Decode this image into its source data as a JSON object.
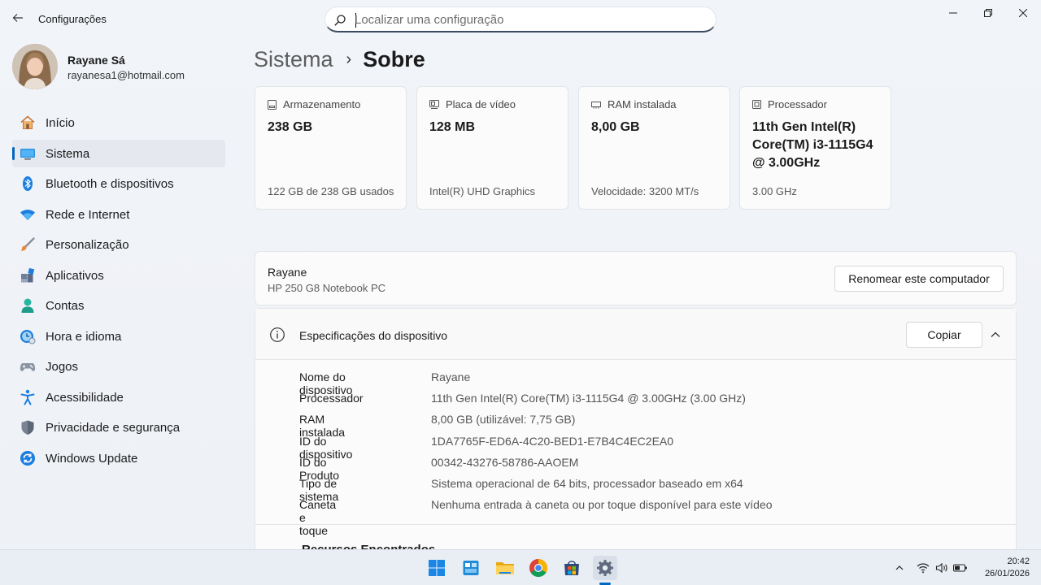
{
  "window": {
    "title": "Configurações",
    "back_icon": "back-arrow-icon",
    "controls": [
      "minimize-icon",
      "maximize-icon",
      "close-icon"
    ]
  },
  "search": {
    "placeholder": "Localizar uma configuração",
    "value": ""
  },
  "profile": {
    "name": "Rayane Sá",
    "email": "rayanesa1@hotmail.com"
  },
  "sidebar": {
    "items": [
      {
        "label": "Início",
        "icon": "home-icon",
        "active": false
      },
      {
        "label": "Sistema",
        "icon": "monitor-icon",
        "active": true
      },
      {
        "label": "Bluetooth e dispositivos",
        "icon": "bluetooth-icon",
        "active": false
      },
      {
        "label": "Rede e Internet",
        "icon": "wifi-icon",
        "active": false
      },
      {
        "label": "Personalização",
        "icon": "brush-icon",
        "active": false
      },
      {
        "label": "Aplicativos",
        "icon": "apps-icon",
        "active": false
      },
      {
        "label": "Contas",
        "icon": "person-icon",
        "active": false
      },
      {
        "label": "Hora e idioma",
        "icon": "clock-globe-icon",
        "active": false
      },
      {
        "label": "Jogos",
        "icon": "gamepad-icon",
        "active": false
      },
      {
        "label": "Acessibilidade",
        "icon": "accessibility-icon",
        "active": false
      },
      {
        "label": "Privacidade e segurança",
        "icon": "shield-icon",
        "active": false
      },
      {
        "label": "Windows Update",
        "icon": "update-icon",
        "active": false
      }
    ]
  },
  "breadcrumb": {
    "parent": "Sistema",
    "separator": "›",
    "current": "Sobre"
  },
  "cards": [
    {
      "title": "Armazenamento",
      "value": "238 GB",
      "sub": "122 GB de 238 GB usados",
      "icon": "storage-icon"
    },
    {
      "title": "Placa de vídeo",
      "value": "128 MB",
      "sub": "Intel(R) UHD Graphics",
      "icon": "gpu-icon"
    },
    {
      "title": "RAM instalada",
      "value": "8,00 GB",
      "sub": "Velocidade: 3200 MT/s",
      "icon": "ram-icon"
    },
    {
      "title": "Processador",
      "value": "11th Gen Intel(R) Core(TM) i3-1115G4 @ 3.00GHz",
      "sub": "3.00 GHz",
      "icon": "cpu-icon"
    }
  ],
  "device": {
    "name": "Rayane",
    "model": "HP 250 G8 Notebook PC",
    "rename_label": "Renomear este computador"
  },
  "specs": {
    "title": "Especificações do dispositivo",
    "copy_label": "Copiar",
    "rows": [
      {
        "label": "Nome do dispositivo",
        "value": "Rayane"
      },
      {
        "label": "Processador",
        "value": "11th Gen Intel(R) Core(TM) i3-1115G4 @ 3.00GHz (3.00 GHz)"
      },
      {
        "label": "RAM instalada",
        "value": "8,00 GB (utilizável: 7,75 GB)"
      },
      {
        "label": "ID do dispositivo",
        "value": "1DA7765F-ED6A-4C20-BED1-E7B4C4EC2EA0"
      },
      {
        "label": "ID do Produto",
        "value": "00342-43276-58786-AAOEM"
      },
      {
        "label": "Tipo de sistema",
        "value": "Sistema operacional de 64 bits, processador baseado em x64"
      },
      {
        "label": "Caneta e toque",
        "value": "Nenhuma entrada à caneta ou por toque disponível para este vídeo"
      }
    ],
    "related_partial": "Recursos Encontrados"
  },
  "taskbar": {
    "apps": [
      "windows-start-icon",
      "store-icon",
      "file-explorer-icon",
      "chrome-icon",
      "microsoft-store-icon",
      "settings-gear-icon"
    ],
    "tray": [
      "chevron-up-icon",
      "wifi-icon",
      "speaker-icon",
      "battery-icon"
    ],
    "time": "20:42",
    "date": "26/01/2026"
  },
  "colors": {
    "accent": "#0067c0",
    "background": "#eef2f7",
    "card": "#fbfbfb"
  }
}
